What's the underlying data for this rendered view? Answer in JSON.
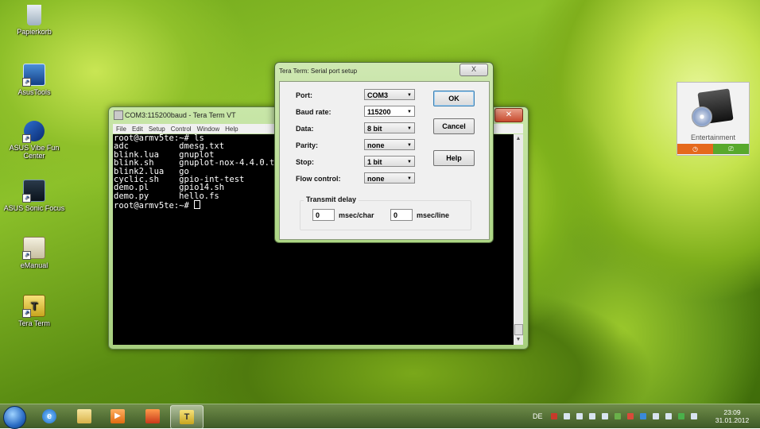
{
  "desktop": {
    "icons": [
      {
        "label": "Papierkorb"
      },
      {
        "label": "AsusTools"
      },
      {
        "label": "ASUS Vibe Fun Center"
      },
      {
        "label": "ASUS Sonic Focus"
      },
      {
        "label": "eManual"
      },
      {
        "label": "Tera Term"
      }
    ]
  },
  "teraterm": {
    "title": "COM3:115200baud - Tera Term VT",
    "menu": [
      "File",
      "Edit",
      "Setup",
      "Control",
      "Window",
      "Help"
    ],
    "terminal_lines": [
      "root@armv5te:~# ls",
      "adc          dmesg.txt",
      "blink.lua    gnuplot",
      "blink.sh     gnuplot-nox-4.4.0.tg",
      "blink2.lua   go",
      "cyclic.sh    gpio-int-test",
      "demo.pl      gpio14.sh",
      "demo.py      hello.fs",
      "root@armv5te:~# "
    ]
  },
  "dialog": {
    "title": "Tera Term: Serial port setup",
    "close": "X",
    "fields": [
      {
        "label": "Port:",
        "value": "COM3"
      },
      {
        "label": "Baud rate:",
        "value": "115200"
      },
      {
        "label": "Data:",
        "value": "8 bit"
      },
      {
        "label": "Parity:",
        "value": "none"
      },
      {
        "label": "Stop:",
        "value": "1 bit"
      },
      {
        "label": "Flow control:",
        "value": "none"
      }
    ],
    "buttons": {
      "ok": "OK",
      "cancel": "Cancel",
      "help": "Help"
    },
    "transmit_delay": {
      "title": "Transmit delay",
      "char_value": "0",
      "char_unit": "msec/char",
      "line_value": "0",
      "line_unit": "msec/line"
    }
  },
  "gadget": {
    "label": "Entertainment"
  },
  "taskbar": {
    "language": "DE",
    "time": "23:09",
    "date": "31.01.2012"
  },
  "colors": {
    "terminal_bg": "#000000",
    "terminal_fg": "#ffffff",
    "window_frame": "#a7cf7e"
  }
}
